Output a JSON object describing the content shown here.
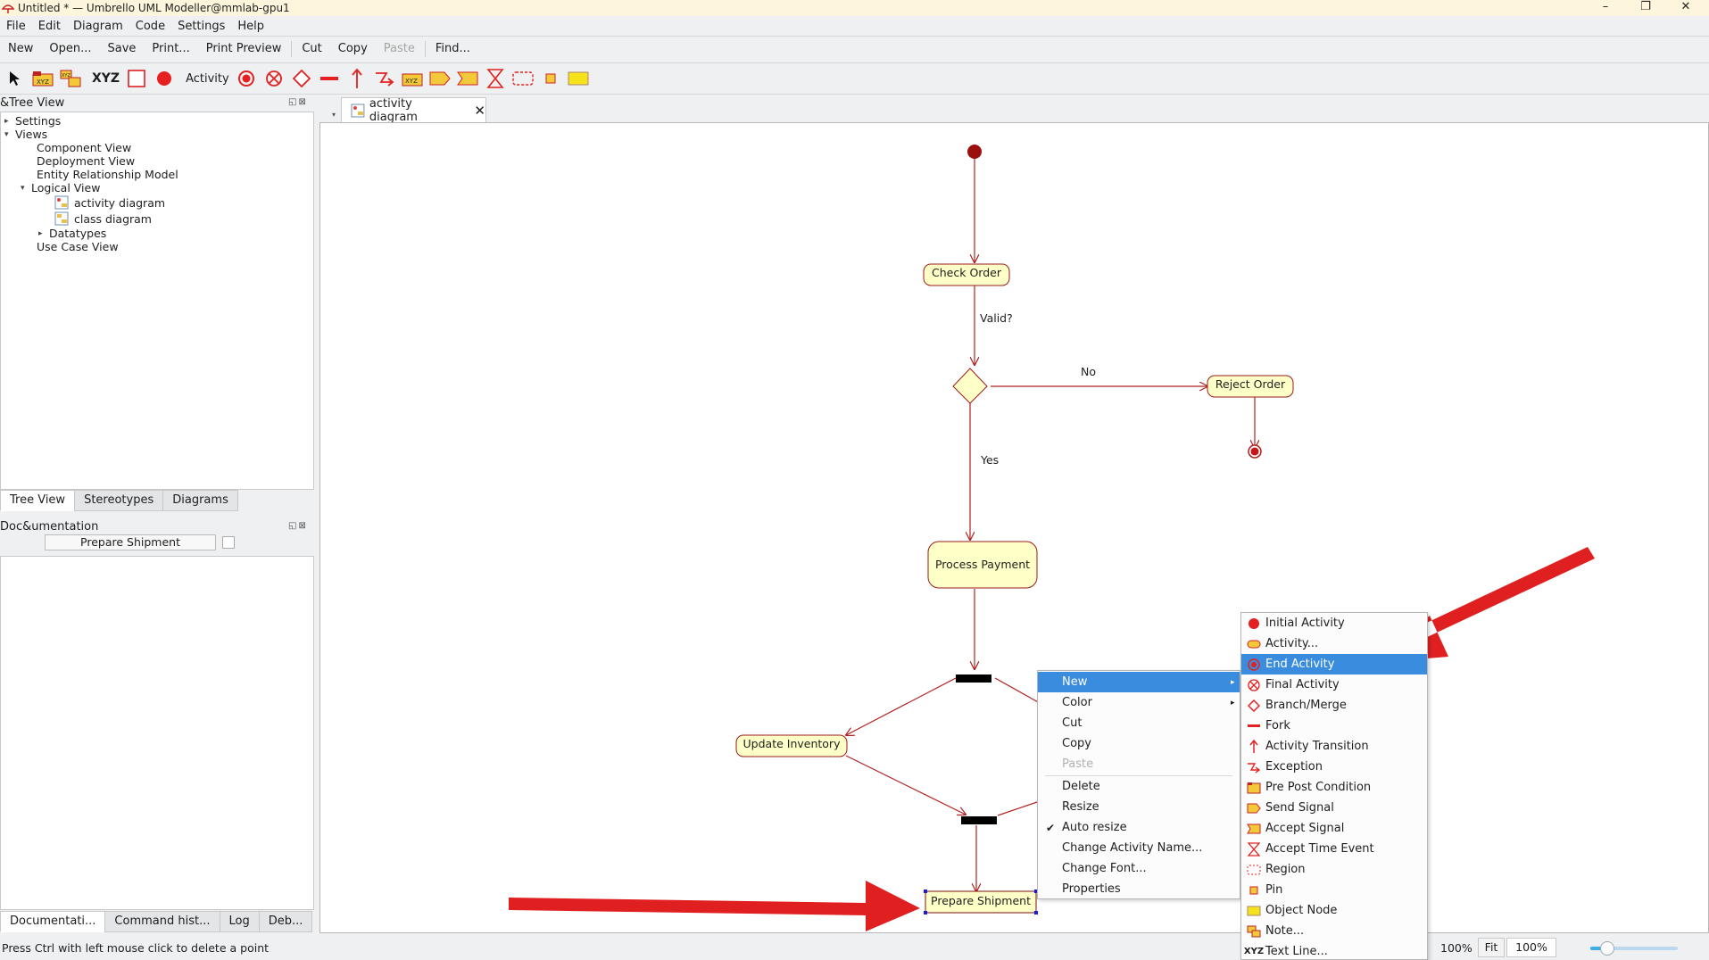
{
  "window": {
    "title": "Untitled * — Umbrello UML Modeller@mmlab-gpu1",
    "minimize": "–",
    "restore": "❐",
    "close": "✕"
  },
  "menubar": [
    "File",
    "Edit",
    "Diagram",
    "Code",
    "Settings",
    "Help"
  ],
  "toolbar": {
    "new": "New",
    "open": "Open...",
    "save": "Save",
    "print": "Print...",
    "print_preview": "Print Preview",
    "cut": "Cut",
    "copy": "Copy",
    "paste": "Paste",
    "find": "Find..."
  },
  "palette": {
    "xyz_label": "XYZ",
    "activity_label": "Activity"
  },
  "tree_panel": {
    "title": "&Tree View",
    "items": [
      {
        "label": "Settings"
      },
      {
        "label": "Views"
      },
      {
        "label": "Component View"
      },
      {
        "label": "Deployment View"
      },
      {
        "label": "Entity Relationship Model"
      },
      {
        "label": "Logical View"
      },
      {
        "label": "activity diagram"
      },
      {
        "label": "class diagram"
      },
      {
        "label": "Datatypes"
      },
      {
        "label": "Use Case View"
      }
    ],
    "tabs": [
      "Tree View",
      "Stereotypes",
      "Diagrams"
    ]
  },
  "doc_panel": {
    "title": "Doc&umentation",
    "field_value": "Prepare Shipment",
    "bottom_tabs": [
      "Documentati...",
      "Command hist...",
      "Log",
      "Deb..."
    ]
  },
  "canvas_tab": {
    "label": "activity diagram"
  },
  "diagram": {
    "nodes": {
      "check_order": "Check Order",
      "reject_order": "Reject Order",
      "process_payment": "Process Payment",
      "update_inventory": "Update Inventory",
      "prepare_shipment": "Prepare Shipment"
    },
    "labels": {
      "valid": "Valid?",
      "no": "No",
      "yes": "Yes"
    },
    "colors": {
      "node_fill": "#ffffc8",
      "node_stroke": "#9e1b1b",
      "edge": "#b02020",
      "annotation_arrow": "#e02020"
    }
  },
  "context_menu": {
    "items": [
      {
        "label": "New",
        "highlighted": true,
        "submenu": true
      },
      {
        "label": "Color",
        "submenu": true
      },
      {
        "label": "Cut"
      },
      {
        "label": "Copy"
      },
      {
        "label": "Paste",
        "disabled": true
      },
      {
        "label": "Delete"
      },
      {
        "label": "Resize"
      },
      {
        "label": "Auto resize",
        "checked": true
      },
      {
        "label": "Change Activity Name..."
      },
      {
        "label": "Change Font..."
      },
      {
        "label": "Properties"
      }
    ]
  },
  "new_submenu": {
    "items": [
      {
        "label": "Initial Activity",
        "icon": "initial-activity-icon"
      },
      {
        "label": "Activity...",
        "icon": "activity-icon"
      },
      {
        "label": "End Activity",
        "icon": "end-activity-icon",
        "highlighted": true
      },
      {
        "label": "Final Activity",
        "icon": "final-activity-icon"
      },
      {
        "label": "Branch/Merge",
        "icon": "branch-merge-icon"
      },
      {
        "label": "Fork",
        "icon": "fork-icon"
      },
      {
        "label": "Activity Transition",
        "icon": "activity-transition-icon"
      },
      {
        "label": "Exception",
        "icon": "exception-icon"
      },
      {
        "label": "Pre Post Condition",
        "icon": "pre-post-condition-icon"
      },
      {
        "label": "Send Signal",
        "icon": "send-signal-icon"
      },
      {
        "label": "Accept Signal",
        "icon": "accept-signal-icon"
      },
      {
        "label": "Accept Time Event",
        "icon": "accept-time-event-icon"
      },
      {
        "label": "Region",
        "icon": "region-icon"
      },
      {
        "label": "Pin",
        "icon": "pin-icon"
      },
      {
        "label": "Object Node",
        "icon": "object-node-icon"
      },
      {
        "label": "Note...",
        "icon": "note-icon"
      },
      {
        "label": "Text Line...",
        "icon": "text-line-icon"
      }
    ]
  },
  "statusbar": {
    "message": "Press Ctrl with left mouse click to delete a point",
    "zoom_label": "100%",
    "fit": "Fit",
    "zoom_value": "100%",
    "zoom_slider_fraction": 0.2
  }
}
